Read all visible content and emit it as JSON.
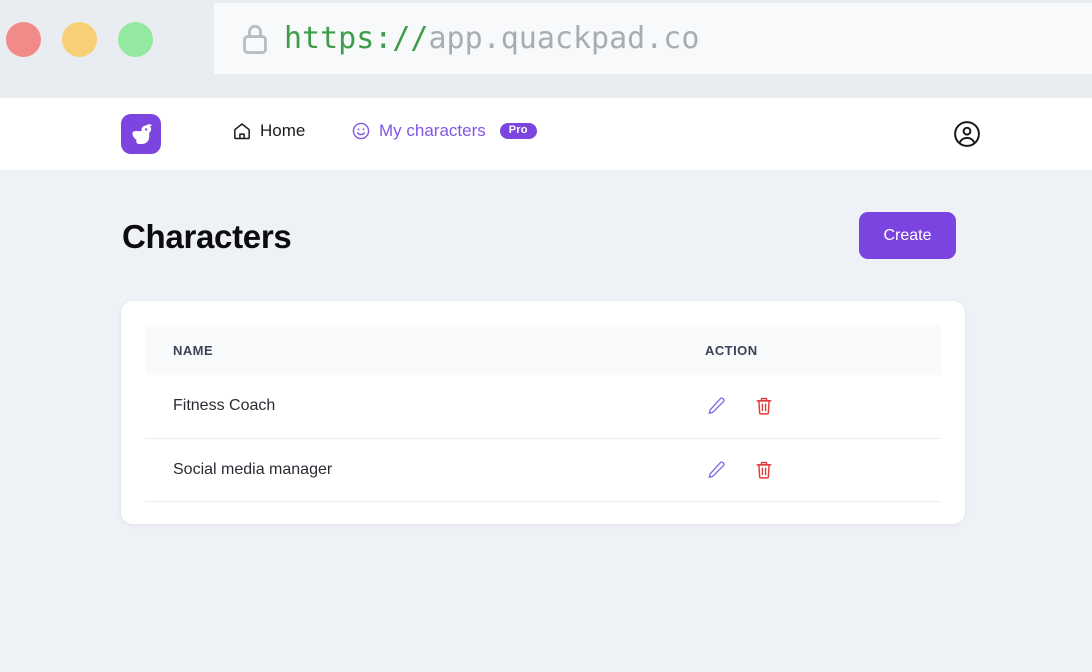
{
  "browser": {
    "traffic_lights": [
      {
        "name": "close",
        "color": "#f28a87"
      },
      {
        "name": "minimize",
        "color": "#f8cf74"
      },
      {
        "name": "maximize",
        "color": "#93e9a0"
      }
    ],
    "lock_icon": "lock-icon",
    "url_scheme": "https://",
    "url_host": "app.quackpad.co",
    "url_full": "https://app.quackpad.co"
  },
  "nav": {
    "logo_icon": "duck-logo-icon",
    "logo_bg": "#7c45e0",
    "links": [
      {
        "label": "Home",
        "icon": "home-icon",
        "active": false
      },
      {
        "label": "My characters",
        "icon": "smiley-icon",
        "active": true,
        "badge": "Pro"
      }
    ],
    "account_icon": "account-circle-icon"
  },
  "page": {
    "title": "Characters",
    "create_label": "Create",
    "accent_color": "#7b44e0"
  },
  "table": {
    "columns": [
      "NAME",
      "ACTION"
    ],
    "rows": [
      {
        "name": "Fitness Coach",
        "actions": [
          {
            "name": "edit-icon",
            "label": "Edit",
            "color": "#8b6ee8"
          },
          {
            "name": "delete-icon",
            "label": "Delete",
            "color": "#e03b3b"
          }
        ]
      },
      {
        "name": "Social media manager",
        "actions": [
          {
            "name": "edit-icon",
            "label": "Edit",
            "color": "#8b6ee8"
          },
          {
            "name": "delete-icon",
            "label": "Delete",
            "color": "#e03b3b"
          }
        ]
      }
    ]
  }
}
